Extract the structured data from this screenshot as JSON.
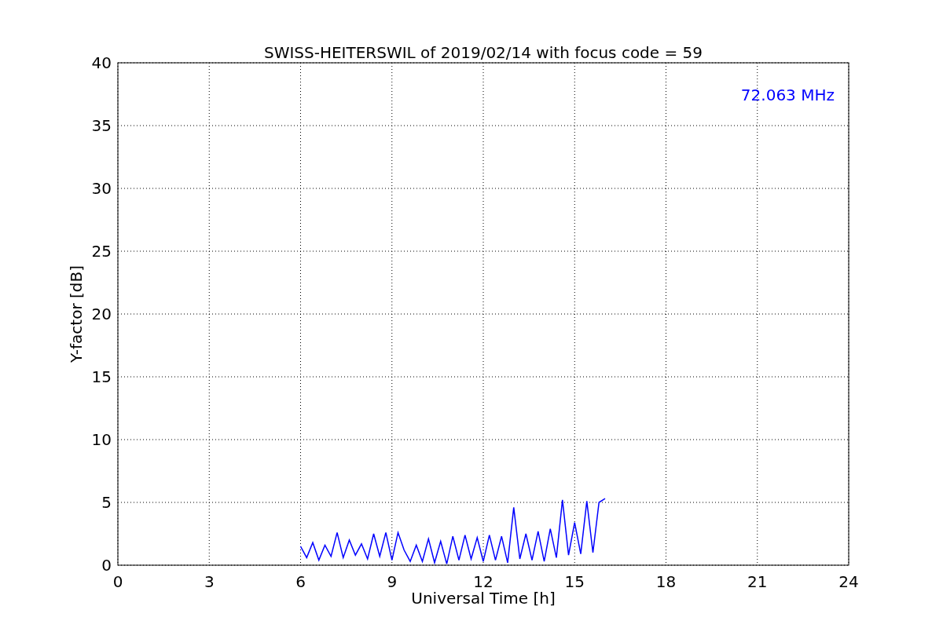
{
  "chart_data": {
    "type": "line",
    "title": "SWISS-HEITERSWIL of 2019/02/14 with focus code = 59",
    "xlabel": "Universal Time [h]",
    "ylabel": "Y-factor [dB]",
    "x": [
      6.0,
      6.2,
      6.4,
      6.6,
      6.8,
      7.0,
      7.2,
      7.4,
      7.6,
      7.8,
      8.0,
      8.2,
      8.4,
      8.6,
      8.8,
      9.0,
      9.2,
      9.4,
      9.6,
      9.8,
      10.0,
      10.2,
      10.4,
      10.6,
      10.8,
      11.0,
      11.2,
      11.4,
      11.6,
      11.8,
      12.0,
      12.2,
      12.4,
      12.6,
      12.8,
      13.0,
      13.2,
      13.4,
      13.6,
      13.8,
      14.0,
      14.2,
      14.4,
      14.6,
      14.8,
      15.0,
      15.2,
      15.4,
      15.6,
      15.8,
      16.0
    ],
    "series": [
      {
        "name": "72.063 MHz",
        "color": "#0000ff",
        "values": [
          1.5,
          0.6,
          1.8,
          0.4,
          1.6,
          0.7,
          2.6,
          0.6,
          2.0,
          0.8,
          1.7,
          0.5,
          2.5,
          0.7,
          2.6,
          0.4,
          2.6,
          1.2,
          0.3,
          1.6,
          0.3,
          2.1,
          0.2,
          1.9,
          0.1,
          2.3,
          0.4,
          2.4,
          0.5,
          2.2,
          0.3,
          2.4,
          0.4,
          2.3,
          0.2,
          4.6,
          0.5,
          2.5,
          0.4,
          2.7,
          0.3,
          2.9,
          0.6,
          5.2,
          0.8,
          3.4,
          0.9,
          5.1,
          1.0,
          5.0,
          5.3
        ]
      }
    ],
    "xlim": [
      0,
      24
    ],
    "ylim": [
      0,
      40
    ],
    "xticks": [
      0,
      3,
      6,
      9,
      12,
      15,
      18,
      21,
      24
    ],
    "yticks": [
      0,
      5,
      10,
      15,
      20,
      25,
      30,
      35,
      40
    ],
    "grid": true
  }
}
